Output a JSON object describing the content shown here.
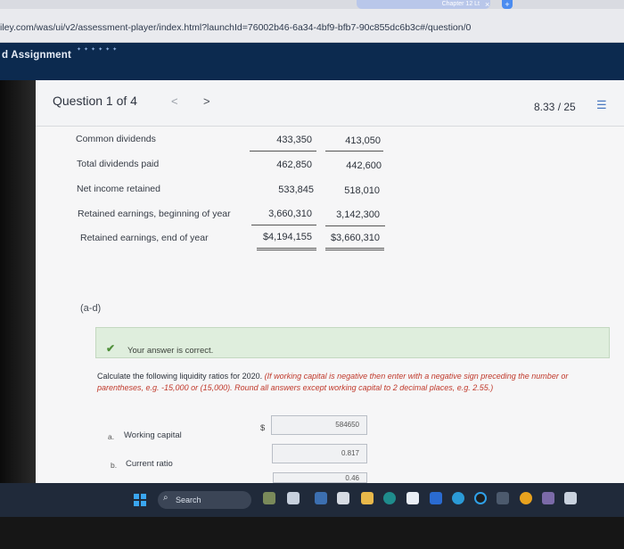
{
  "browser": {
    "tab_title": "Chapter 12 Lt",
    "url": "iley.com/was/ui/v2/assessment-player/index.html?launchId=76002b46-6a34-4bf9-bfb7-90c855dc6b3c#/question/0"
  },
  "app": {
    "title": "d Assignment"
  },
  "question_nav": {
    "label": "Question 1 of 4",
    "prev": "<",
    "next": ">",
    "score": "8.33 / 25",
    "list_icon": "list-icon"
  },
  "table": {
    "rows": [
      {
        "label": "Common dividends",
        "v2020": "433,350",
        "v2019": "413,050"
      },
      {
        "label": "Total dividends paid",
        "v2020": "462,850",
        "v2019": "442,600"
      },
      {
        "label": "Net income retained",
        "v2020": "533,845",
        "v2019": "518,010"
      },
      {
        "label": "Retained earnings, beginning of year",
        "v2020": "3,660,310",
        "v2019": "3,142,300"
      },
      {
        "label": "Retained earnings, end of year",
        "v2020": "$4,194,155",
        "v2019": "$3,660,310"
      }
    ]
  },
  "part": {
    "label": "(a-d)"
  },
  "feedback": {
    "icon": "check-icon",
    "text": "Your answer is correct."
  },
  "instructions": {
    "main": "Calculate the following liquidity ratios for 2020.",
    "note": "(If working capital is negative then enter with a negative sign preceding the number or parentheses, e.g. -15,000 or (15,000). Round all answers except working capital to 2 decimal places, e.g. 2.55.)"
  },
  "answers": [
    {
      "letter": "a.",
      "label": "Working capital",
      "prefix": "$",
      "value": "584650"
    },
    {
      "letter": "b.",
      "label": "Current ratio",
      "prefix": "",
      "value": "0.817"
    },
    {
      "letter": "",
      "label": "",
      "prefix": "",
      "value": "0.46"
    }
  ],
  "taskbar": {
    "search_label": "Search",
    "colors": {
      "bg": "#202a3a",
      "accent": "#3aa6f0"
    }
  },
  "colors": {
    "header": "#0c2a4f",
    "success_bg": "#dfeedd",
    "success_icon": "#4f8f3a"
  }
}
